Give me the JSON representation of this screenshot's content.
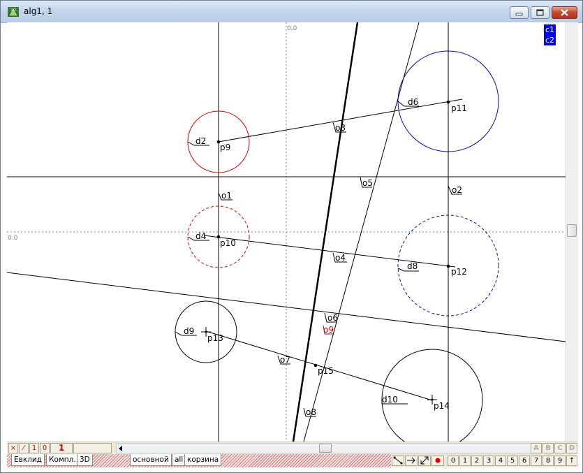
{
  "window": {
    "title": "alg1, 1",
    "buttons": [
      "minimize",
      "maximize",
      "close"
    ]
  },
  "axis_labels": {
    "x_origin": "0.0",
    "y_origin": "0.0"
  },
  "layers_panel": {
    "items": [
      "c1",
      "c2"
    ]
  },
  "geometry_labels": {
    "d2": "d2",
    "d4": "d4",
    "d6": "d6",
    "d8": "d8",
    "d9": "d9",
    "d10": "d10",
    "o1": "o1",
    "o2": "o2",
    "o3": "o3",
    "o4": "o4",
    "o5": "o5",
    "o6": "o6",
    "o7": "o7",
    "o8": "o8",
    "o9": "o9",
    "p9": "p9",
    "p10": "p10",
    "p11": "p11",
    "p12": "p12",
    "p13": "p13",
    "p14": "p14",
    "p15": "p15"
  },
  "colors": {
    "red_circle": "#e00000",
    "blue_circle": "#0000cc",
    "label_red": "#e00000",
    "layer_bg": "#0000ee"
  },
  "toolbar_left": {
    "cross": "×",
    "slash": "⁄",
    "one": "1",
    "zero": "0",
    "big_one": "1"
  },
  "tabs_left": [
    "Евклид",
    "Компл.",
    "3D"
  ],
  "tabs_mid": [
    "основной",
    "all",
    "корзина"
  ],
  "right_letters": [
    "A",
    "B",
    "C",
    "D"
  ],
  "number_buttons": [
    "0",
    "1",
    "2",
    "3",
    "4",
    "5",
    "6",
    "7",
    "8",
    "9",
    "↑"
  ],
  "tool_icons": [
    "segment-tool-icon",
    "arrow-tool-icon",
    "vector-tool-icon",
    "point-tool-icon"
  ]
}
